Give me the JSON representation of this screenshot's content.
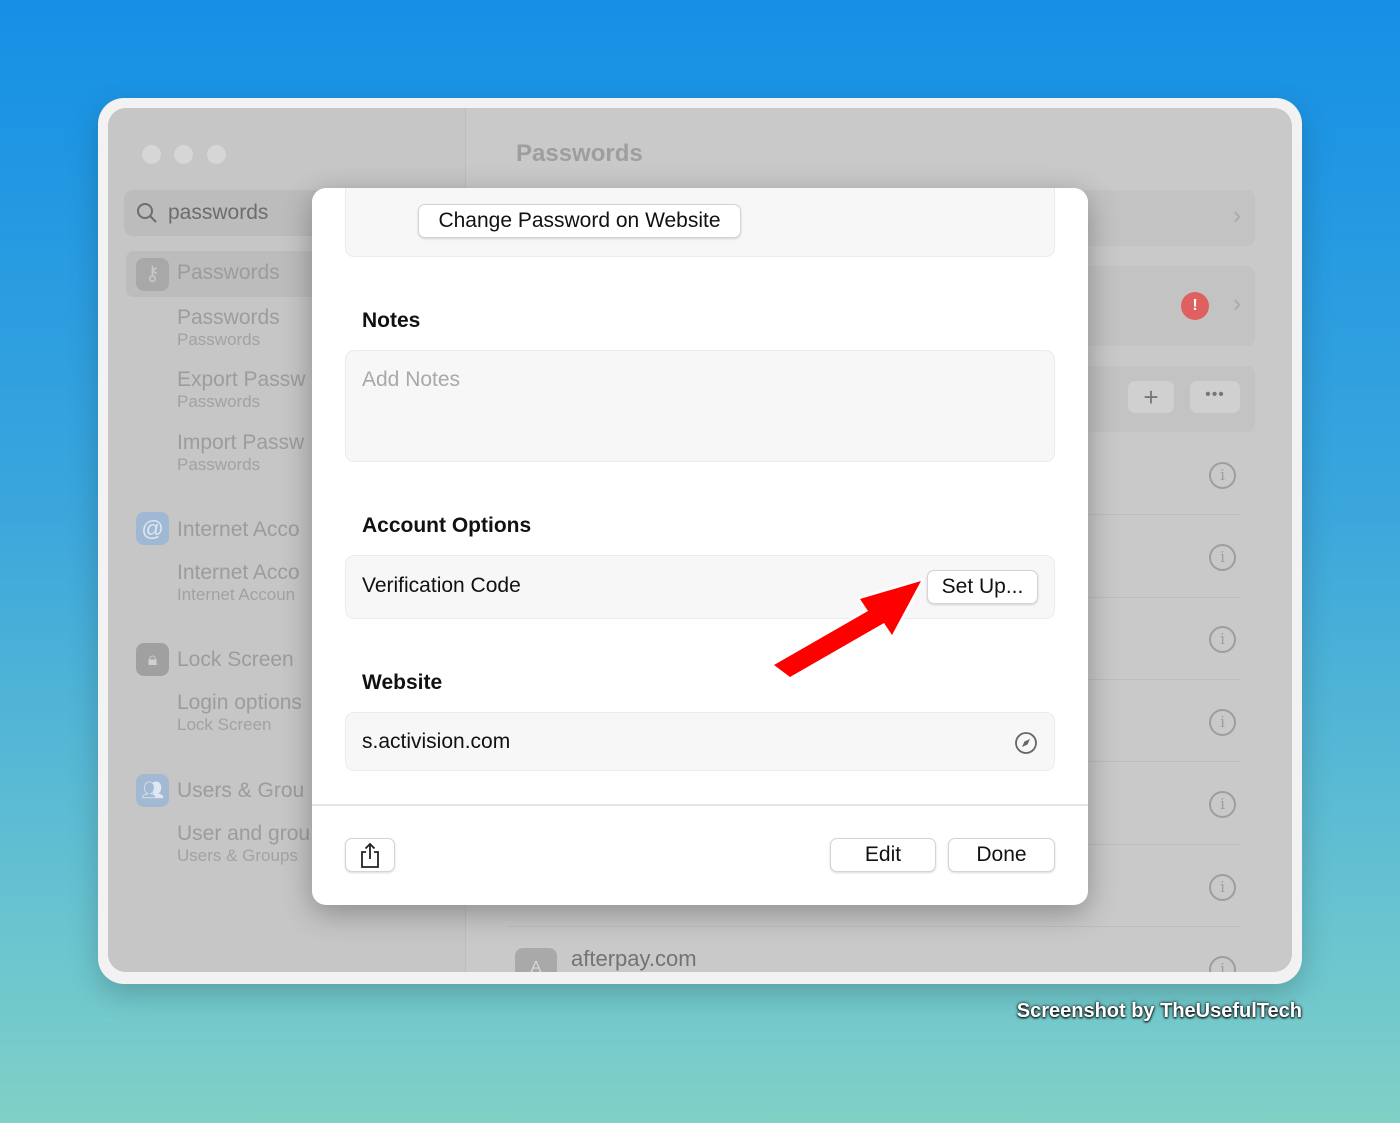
{
  "window": {
    "title": "Passwords"
  },
  "sidebar": {
    "search_value": "passwords",
    "items": [
      {
        "label": "Passwords",
        "icon": "key-icon",
        "selected": true
      },
      {
        "label": "Passwords",
        "sub": "Passwords"
      },
      {
        "label": "Export Passw",
        "sub": "Passwords"
      },
      {
        "label": "Import Passw",
        "sub": "Passwords"
      },
      {
        "label": "Internet Acco",
        "icon": "at-icon"
      },
      {
        "label": "Internet Acco",
        "sub": "Internet Accoun"
      },
      {
        "label": "Lock Screen",
        "icon": "lock-icon"
      },
      {
        "label": "Login options",
        "sub": "Lock Screen"
      },
      {
        "label": "Users & Grou",
        "icon": "users-icon"
      },
      {
        "label": "User and grou",
        "sub": "Users & Groups"
      }
    ]
  },
  "main": {
    "list_last_item": "afterpay.com",
    "list_last_initial": "A",
    "warning_color": "#e06060"
  },
  "modal": {
    "change_password_label": "Change Password on Website",
    "notes_heading": "Notes",
    "notes_placeholder": "Add Notes",
    "account_options_heading": "Account Options",
    "verification_label": "Verification Code",
    "setup_label": "Set Up...",
    "website_heading": "Website",
    "website_value": "s.activision.com",
    "edit_label": "Edit",
    "done_label": "Done"
  },
  "annotation": {
    "arrow_color": "#ff0000"
  },
  "credit": "Screenshot by TheUsefulTech"
}
